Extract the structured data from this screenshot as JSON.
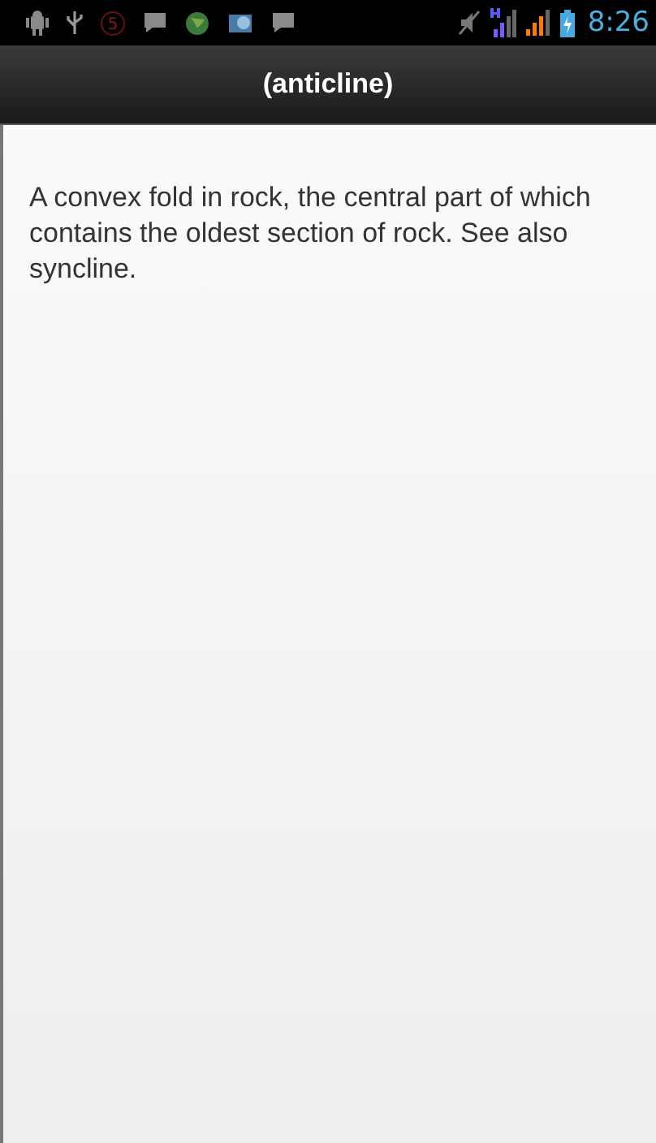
{
  "status_bar": {
    "badge": "5",
    "time": "8:26"
  },
  "title_bar": {
    "title": "(anticline)"
  },
  "definition": "A convex fold in rock, the central part of which contains the oldest section of rock. See also syncline."
}
